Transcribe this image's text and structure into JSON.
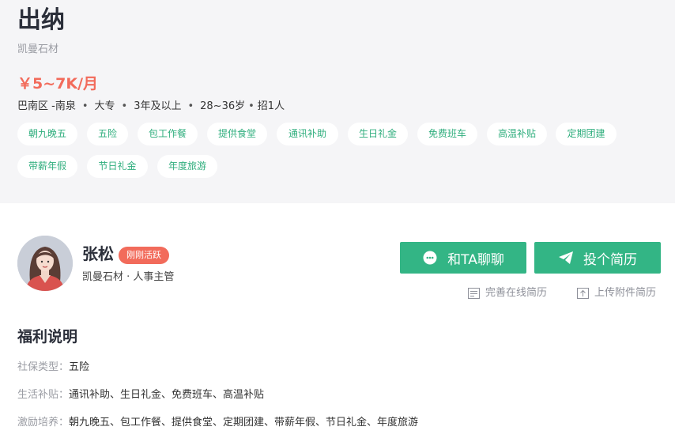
{
  "job": {
    "title": "出纳",
    "company": "凯曼石材",
    "salary": "￥5~7K/月",
    "meta": [
      "巴南区 -南泉",
      "大专",
      "3年及以上",
      "28~36岁",
      "招1人"
    ],
    "tags_row1": [
      "朝九晚五",
      "五险",
      "包工作餐",
      "提供食堂",
      "通讯补助",
      "生日礼金",
      "免费班车",
      "高温补贴",
      "定期团建"
    ],
    "tags_row2": [
      "带薪年假",
      "节日礼金",
      "年度旅游"
    ]
  },
  "recruiter": {
    "name": "张松",
    "badge": "刚刚活跃",
    "subtitle": "凯曼石材 · 人事主管"
  },
  "actions": {
    "chat_label": "和TA聊聊",
    "apply_label": "投个简历",
    "resume_link": "完善在线简历",
    "upload_link": "上传附件简历"
  },
  "benefits": {
    "title": "福利说明",
    "rows": [
      {
        "key": "社保类型：",
        "value": "五险"
      },
      {
        "key": "生活补贴：",
        "value": "通讯补助、生日礼金、免费班车、高温补贴"
      },
      {
        "key": "激励培养：",
        "value": "朝九晚五、包工作餐、提供食堂、定期团建、带薪年假、节日礼金、年度旅游"
      }
    ]
  },
  "colors": {
    "accent": "#33b585",
    "salary": "#f26b5b",
    "tag_text": "#2fae7d",
    "header_bg": "#f5f5f7"
  }
}
